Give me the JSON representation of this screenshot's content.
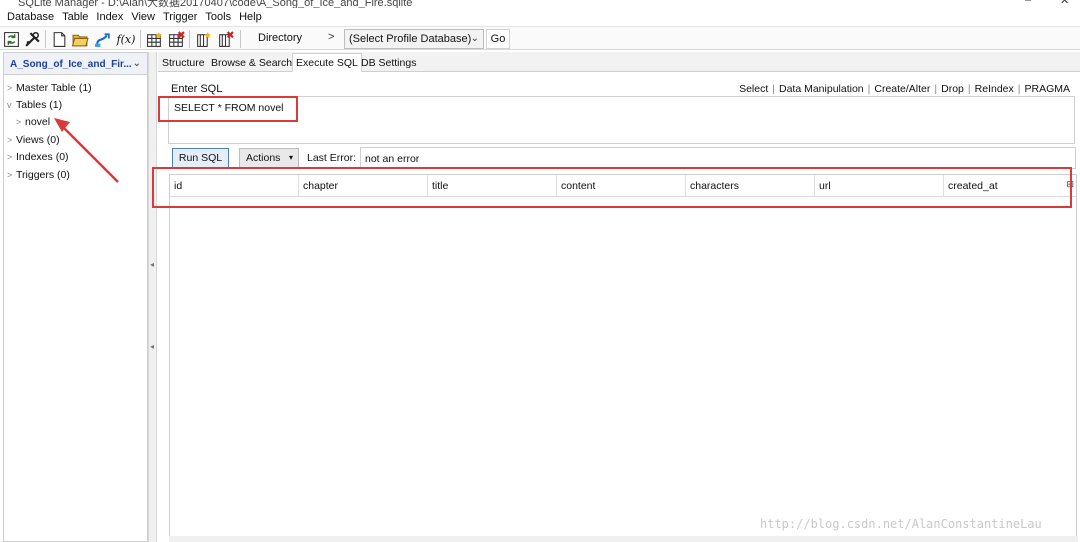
{
  "window": {
    "title": "SQLite Manager - D:\\Alan\\大数据20170407\\code\\A_Song_of_Ice_and_Fire.sqlite"
  },
  "menubar": {
    "items": [
      "Database",
      "Table",
      "Index",
      "View",
      "Trigger",
      "Tools",
      "Help"
    ]
  },
  "toolbar": {
    "directory_label": "Directory",
    "directory_arrow": ">",
    "profile_select": "(Select Profile Database)",
    "go_label": "Go",
    "icons": [
      "refresh-icon",
      "tools-icon",
      "new-file-icon",
      "open-folder-icon",
      "connect-icon",
      "function-icon",
      "create-table-icon",
      "drop-table-icon",
      "create-index-icon",
      "drop-index-icon"
    ]
  },
  "sidebar": {
    "db_name": "A_Song_of_Ice_and_Fir...",
    "items": [
      {
        "label": "Master Table (1)",
        "twisty": ">"
      },
      {
        "label": "Tables (1)",
        "twisty": "v"
      },
      {
        "label": "novel",
        "twisty": ">"
      },
      {
        "label": "Views (0)",
        "twisty": ">"
      },
      {
        "label": "Indexes (0)",
        "twisty": ">"
      },
      {
        "label": "Triggers (0)",
        "twisty": ">"
      }
    ]
  },
  "tabs": [
    "Structure",
    "Browse & Search",
    "Execute SQL",
    "DB Settings"
  ],
  "active_tab": "Execute SQL",
  "sql": {
    "enter_label": "Enter SQL",
    "links": [
      "Select",
      "Data Manipulation",
      "Create/Alter",
      "Drop",
      "ReIndex",
      "PRAGMA"
    ],
    "query": "SELECT * FROM novel",
    "run_label": "Run SQL",
    "actions_label": "Actions",
    "last_error_label": "Last Error:",
    "last_error_value": "not an error"
  },
  "results": {
    "columns": [
      "id",
      "chapter",
      "title",
      "content",
      "characters",
      "url",
      "created_at"
    ]
  },
  "annotations": {
    "color": "#d93a3a"
  },
  "watermark": "http://blog.csdn.net/AlanConstantineLau"
}
